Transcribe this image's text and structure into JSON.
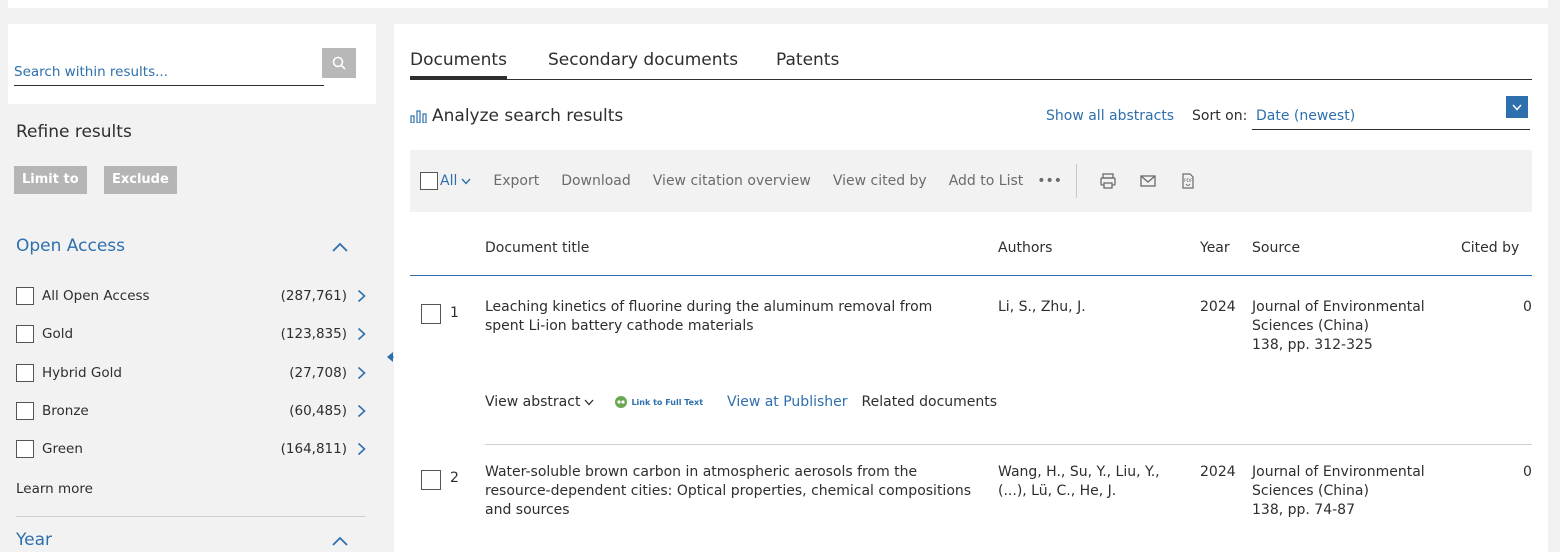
{
  "sidebar": {
    "search_placeholder": "Search within results...",
    "refine_title": "Refine results",
    "limit_label": "Limit to",
    "exclude_label": "Exclude",
    "open_access": {
      "title": "Open Access",
      "items": [
        {
          "label": "All Open Access",
          "count": "(287,761)"
        },
        {
          "label": "Gold",
          "count": "(123,835)"
        },
        {
          "label": "Hybrid Gold",
          "count": "(27,708)"
        },
        {
          "label": "Bronze",
          "count": "(60,485)"
        },
        {
          "label": "Green",
          "count": "(164,811)"
        }
      ],
      "learn_more": "Learn more"
    },
    "year_title": "Year"
  },
  "main": {
    "tabs": [
      {
        "label": "Documents"
      },
      {
        "label": "Secondary documents"
      },
      {
        "label": "Patents"
      }
    ],
    "analyze_label": "Analyze search results",
    "show_abstracts": "Show all abstracts",
    "sort_label": "Sort on:",
    "sort_value": "Date (newest)",
    "toolbar": {
      "all_label": "All",
      "export": "Export",
      "download": "Download",
      "view_citation": "View citation overview",
      "view_cited_by": "View cited by",
      "add_to_list": "Add to List",
      "more": "•••"
    },
    "columns": {
      "title": "Document title",
      "authors": "Authors",
      "year": "Year",
      "source": "Source",
      "cited_by": "Cited by"
    },
    "rows": [
      {
        "num": "1",
        "title_l1": "Leaching kinetics of fluorine during the aluminum removal from",
        "title_l2": "spent Li-ion battery cathode materials",
        "title_l3": "",
        "authors_l1": "Li, S., Zhu, J.",
        "authors_l2": "",
        "year": "2024",
        "source_l1": "Journal of Environmental",
        "source_l2": "Sciences (China)",
        "source_l3": "138, pp. 312-325",
        "cited": "0"
      },
      {
        "num": "2",
        "title_l1": "Water-soluble brown carbon in atmospheric aerosols from the",
        "title_l2": "resource-dependent cities: Optical properties, chemical compositions",
        "title_l3": "and sources",
        "authors_l1": "Wang, H., Su, Y., Liu, Y.,",
        "authors_l2": "(...), Lü, C., He, J.",
        "year": "2024",
        "source_l1": "Journal of Environmental",
        "source_l2": "Sciences (China)",
        "source_l3": "138, pp. 74-87",
        "cited": "0"
      }
    ],
    "row_links": {
      "view_abstract": "View abstract",
      "link_full_text": "Link to Full Text",
      "view_publisher": "View at Publisher",
      "related": "Related documents"
    }
  }
}
